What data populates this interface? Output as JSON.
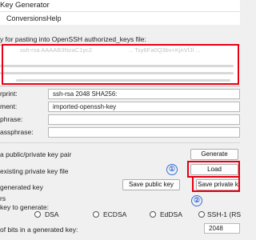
{
  "window": {
    "title": "Key Generator"
  },
  "menu": {
    "items": [
      "Conversions",
      "Help"
    ]
  },
  "public_key": {
    "label": "y for pasting into OpenSSH authorized_keys file:",
    "fragment_top": "ssh-rsa AAAAB3NzaC1yc2",
    "fragment_mid": "... Tsy6Fa0Q3bv+KjnVfJl ..."
  },
  "fields": {
    "fingerprint_label": "rprint:",
    "fingerprint_value": "ssh-rsa 2048 SHA256:",
    "comment_label": "ment:",
    "comment_value": "imported-openssh-key",
    "passphrase_label": "phrase:",
    "confirm_label": "assphrase:"
  },
  "actions": {
    "generate_text": "a public/private key pair",
    "generate_button": "Generate",
    "load_text": "existing private key file",
    "load_button": "Load",
    "save_text": "generated key",
    "save_public_button": "Save public key",
    "save_private_button": "Save private k"
  },
  "annotations": {
    "one": "①",
    "two": "②"
  },
  "parameters": {
    "header": "rs",
    "key_type_label": "key to generate:",
    "key_types": [
      "DSA",
      "ECDSA",
      "EdDSA",
      "SSH-1 (RS"
    ],
    "bits_label": "of bits in a generated key:",
    "bits_value": "2048"
  },
  "colors": {
    "highlight": "#e60012",
    "annotation": "#3d6fd8"
  }
}
